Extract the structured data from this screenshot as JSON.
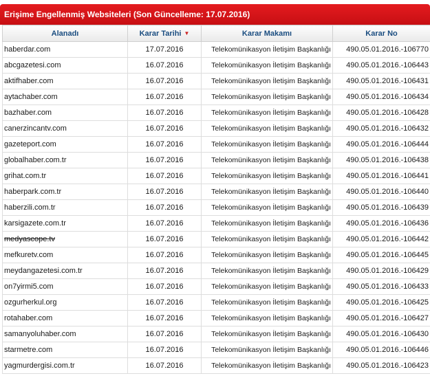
{
  "header": {
    "title": "Erişime Engellenmiş Websiteleri (Son Güncelleme: 17.07.2016)"
  },
  "columns": [
    "Alanadı",
    "Karar Tarihi",
    "Karar Makamı",
    "Karar No"
  ],
  "sorted_column": "Karar Tarihi",
  "rows": [
    {
      "domain": "haberdar.com",
      "date": "17.07.2016",
      "authority": "Telekomünikasyon İletişim Başkanlığı",
      "decision": "490.05.01.2016.-106770"
    },
    {
      "domain": "abcgazetesi.com",
      "date": "16.07.2016",
      "authority": "Telekomünikasyon İletişim Başkanlığı",
      "decision": "490.05.01.2016.-106443"
    },
    {
      "domain": "aktifhaber.com",
      "date": "16.07.2016",
      "authority": "Telekomünikasyon İletişim Başkanlığı",
      "decision": "490.05.01.2016.-106431"
    },
    {
      "domain": "aytachaber.com",
      "date": "16.07.2016",
      "authority": "Telekomünikasyon İletişim Başkanlığı",
      "decision": "490.05.01.2016.-106434"
    },
    {
      "domain": "bazhaber.com",
      "date": "16.07.2016",
      "authority": "Telekomünikasyon İletişim Başkanlığı",
      "decision": "490.05.01.2016.-106428"
    },
    {
      "domain": "canerzincantv.com",
      "date": "16.07.2016",
      "authority": "Telekomünikasyon İletişim Başkanlığı",
      "decision": "490.05.01.2016.-106432"
    },
    {
      "domain": "gazeteport.com",
      "date": "16.07.2016",
      "authority": "Telekomünikasyon İletişim Başkanlığı",
      "decision": "490.05.01.2016.-106444"
    },
    {
      "domain": "globalhaber.com.tr",
      "date": "16.07.2016",
      "authority": "Telekomünikasyon İletişim Başkanlığı",
      "decision": "490.05.01.2016.-106438"
    },
    {
      "domain": "grihat.com.tr",
      "date": "16.07.2016",
      "authority": "Telekomünikasyon İletişim Başkanlığı",
      "decision": "490.05.01.2016.-106441"
    },
    {
      "domain": "haberpark.com.tr",
      "date": "16.07.2016",
      "authority": "Telekomünikasyon İletişim Başkanlığı",
      "decision": "490.05.01.2016.-106440"
    },
    {
      "domain": "haberzili.com.tr",
      "date": "16.07.2016",
      "authority": "Telekomünikasyon İletişim Başkanlığı",
      "decision": "490.05.01.2016.-106439"
    },
    {
      "domain": "karsigazete.com.tr",
      "date": "16.07.2016",
      "authority": "Telekomünikasyon İletişim Başkanlığı",
      "decision": "490.05.01.2016.-106436"
    },
    {
      "domain": "medyascope.tv",
      "date": "16.07.2016",
      "authority": "Telekomünikasyon İletişim Başkanlığı",
      "decision": "490.05.01.2016.-106442",
      "struck": true
    },
    {
      "domain": "mefkuretv.com",
      "date": "16.07.2016",
      "authority": "Telekomünikasyon İletişim Başkanlığı",
      "decision": "490.05.01.2016.-106445"
    },
    {
      "domain": "meydangazetesi.com.tr",
      "date": "16.07.2016",
      "authority": "Telekomünikasyon İletişim Başkanlığı",
      "decision": "490.05.01.2016.-106429"
    },
    {
      "domain": "on7yirmi5.com",
      "date": "16.07.2016",
      "authority": "Telekomünikasyon İletişim Başkanlığı",
      "decision": "490.05.01.2016.-106433"
    },
    {
      "domain": "ozgurherkul.org",
      "date": "16.07.2016",
      "authority": "Telekomünikasyon İletişim Başkanlığı",
      "decision": "490.05.01.2016.-106425"
    },
    {
      "domain": "rotahaber.com",
      "date": "16.07.2016",
      "authority": "Telekomünikasyon İletişim Başkanlığı",
      "decision": "490.05.01.2016.-106427"
    },
    {
      "domain": "samanyoluhaber.com",
      "date": "16.07.2016",
      "authority": "Telekomünikasyon İletişim Başkanlığı",
      "decision": "490.05.01.2016.-106430"
    },
    {
      "domain": "starmetre.com",
      "date": "16.07.2016",
      "authority": "Telekomünikasyon İletişim Başkanlığı",
      "decision": "490.05.01.2016.-106446"
    },
    {
      "domain": "yagmurdergisi.com.tr",
      "date": "16.07.2016",
      "authority": "Telekomünikasyon İletişim Başkanlığı",
      "decision": "490.05.01.2016.-106423"
    }
  ],
  "colors": {
    "header_bg": "#d4151a",
    "header_text": "#ffffff",
    "column_header_text": "#1a4d80",
    "sort_arrow": "#cc2222"
  },
  "icons": {
    "sort": "sort-desc-arrow-icon"
  }
}
